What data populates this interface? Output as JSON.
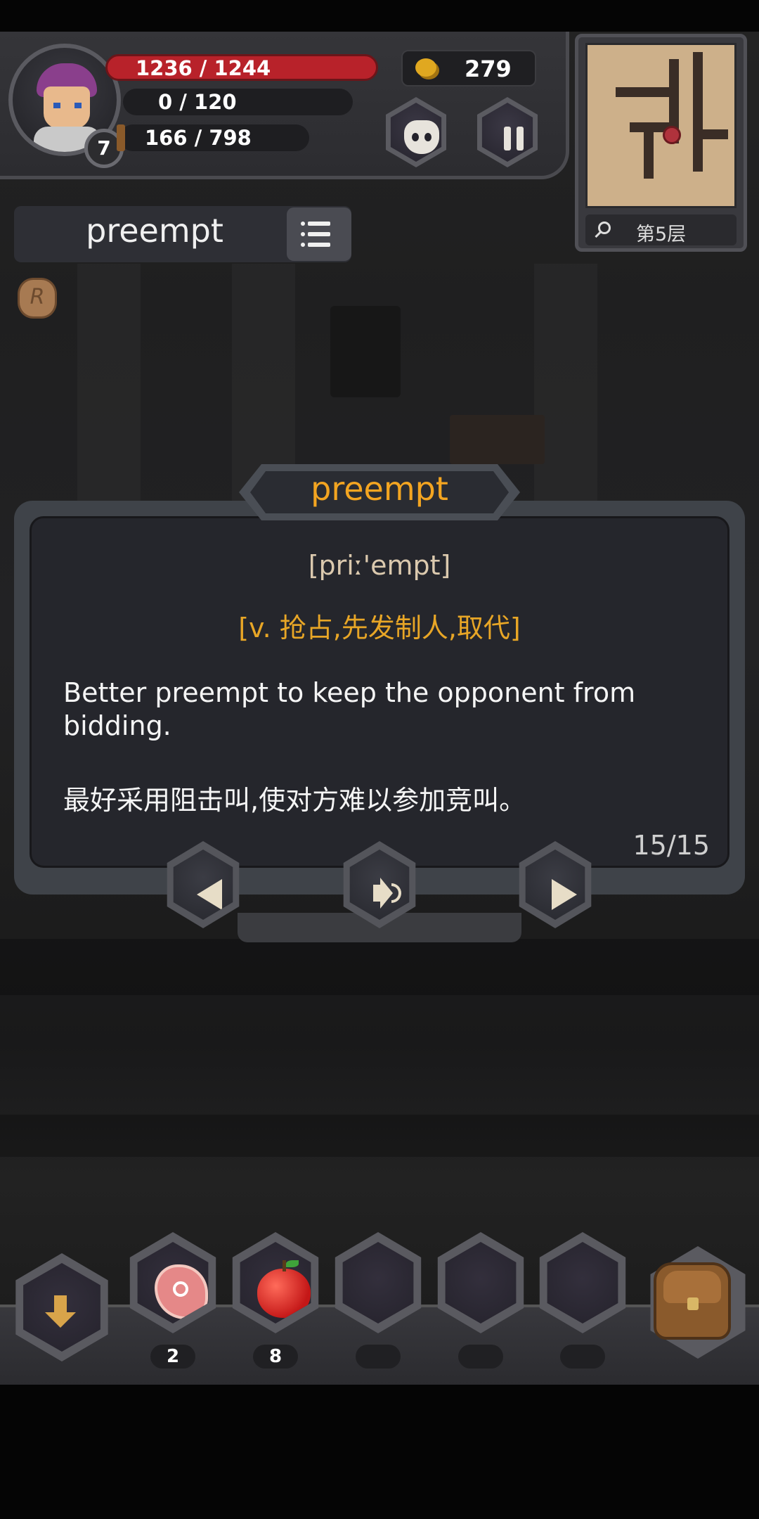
{
  "player": {
    "level": "7",
    "hp": "1236 / 1244",
    "mp": "0 / 120",
    "xp": "166 / 798",
    "gold": "279"
  },
  "map": {
    "floor_label": "第5层"
  },
  "current_word": "preempt",
  "card": {
    "word": "preempt",
    "phonetic": "[priː'empt]",
    "meaning": "[v. 抢占,先发制人,取代]",
    "example_en": "Better preempt to keep the opponent from bidding.",
    "example_zh": "最好采用阻击叫,使对方难以参加竞叫。",
    "page": "15/15"
  },
  "inventory": {
    "slots": [
      {
        "item": "meat",
        "count": "2"
      },
      {
        "item": "apple",
        "count": "8"
      },
      {
        "item": "",
        "count": ""
      },
      {
        "item": "",
        "count": ""
      },
      {
        "item": "",
        "count": ""
      }
    ]
  },
  "icons": {
    "coin": "coin-icon",
    "monster": "monster-icon",
    "pause": "pause-icon",
    "search": "search-icon",
    "list": "list-icon",
    "rune": "rune-icon",
    "prev": "left-arrow-icon",
    "sound": "speaker-icon",
    "next": "right-arrow-icon",
    "drop": "down-arrow-icon",
    "bag": "backpack-icon"
  },
  "colors": {
    "hp": "#b8222a",
    "accent": "#f3a521",
    "meaning": "#e8a626"
  }
}
